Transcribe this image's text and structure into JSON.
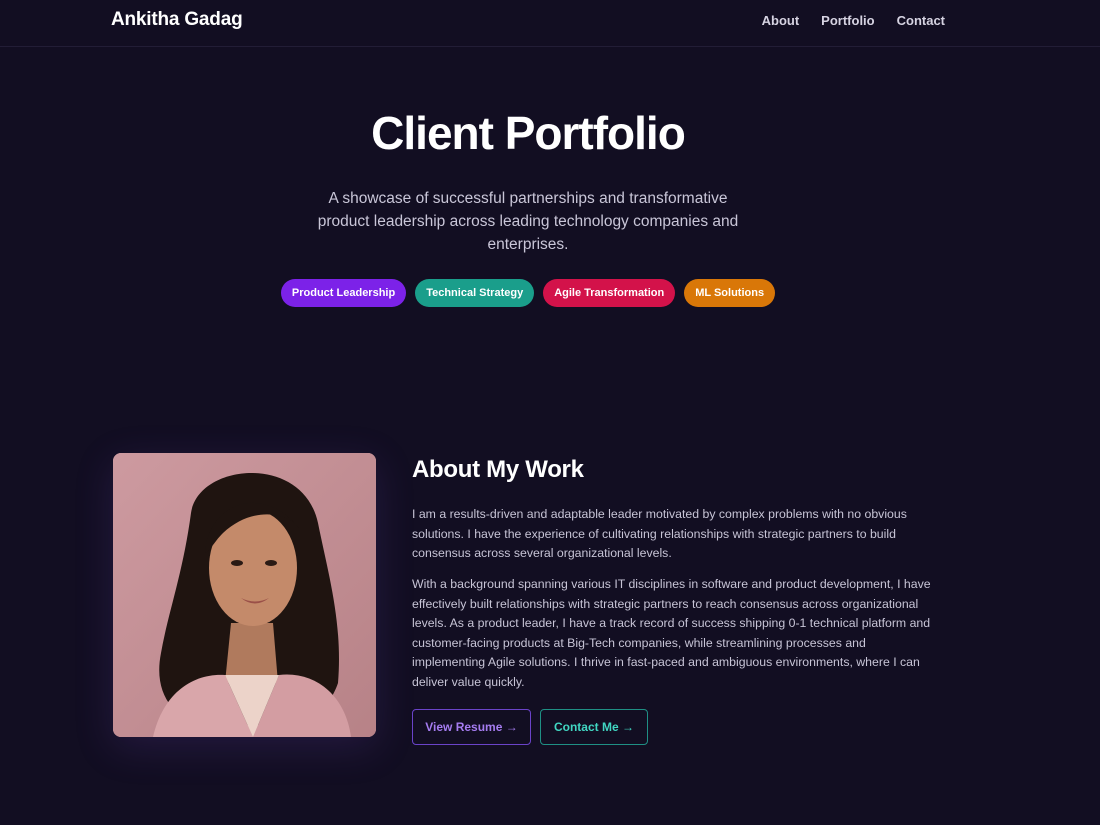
{
  "header": {
    "brand": "Ankitha Gadag",
    "nav": [
      {
        "label": "About"
      },
      {
        "label": "Portfolio"
      },
      {
        "label": "Contact"
      }
    ]
  },
  "hero": {
    "title": "Client Portfolio",
    "subtitle": "A showcase of successful partnerships and transformative product leadership across leading technology companies and enterprises.",
    "tags": [
      {
        "label": "Product Leadership",
        "color": "#7c22e8"
      },
      {
        "label": "Technical Strategy",
        "color": "#1a9e8b"
      },
      {
        "label": "Agile Transformation",
        "color": "#d3124a"
      },
      {
        "label": "ML Solutions",
        "color": "#d97708"
      }
    ]
  },
  "about": {
    "photo_icon": "portrait-photo",
    "title": "About My Work",
    "paragraphs": [
      "I am a results-driven and adaptable leader motivated by complex problems with no obvious solutions. I have the experience of cultivating relationships with strategic partners to build consensus across several organizational levels.",
      "With a background spanning various IT disciplines in software and product development, I have effectively built relationships with strategic partners to reach consensus across organizational levels. As a product leader, I have a track record of success shipping 0-1 technical platform and customer-facing products at Big-Tech companies, while streamlining processes and implementing Agile solutions. I thrive in fast-paced and ambiguous environments, where I can deliver value quickly."
    ],
    "buttons": {
      "resume": "View Resume →",
      "contact": "Contact Me →"
    }
  },
  "colors": {
    "background": "#120e22",
    "resume_accent": "#a57cf0",
    "contact_accent": "#41d6c2"
  }
}
